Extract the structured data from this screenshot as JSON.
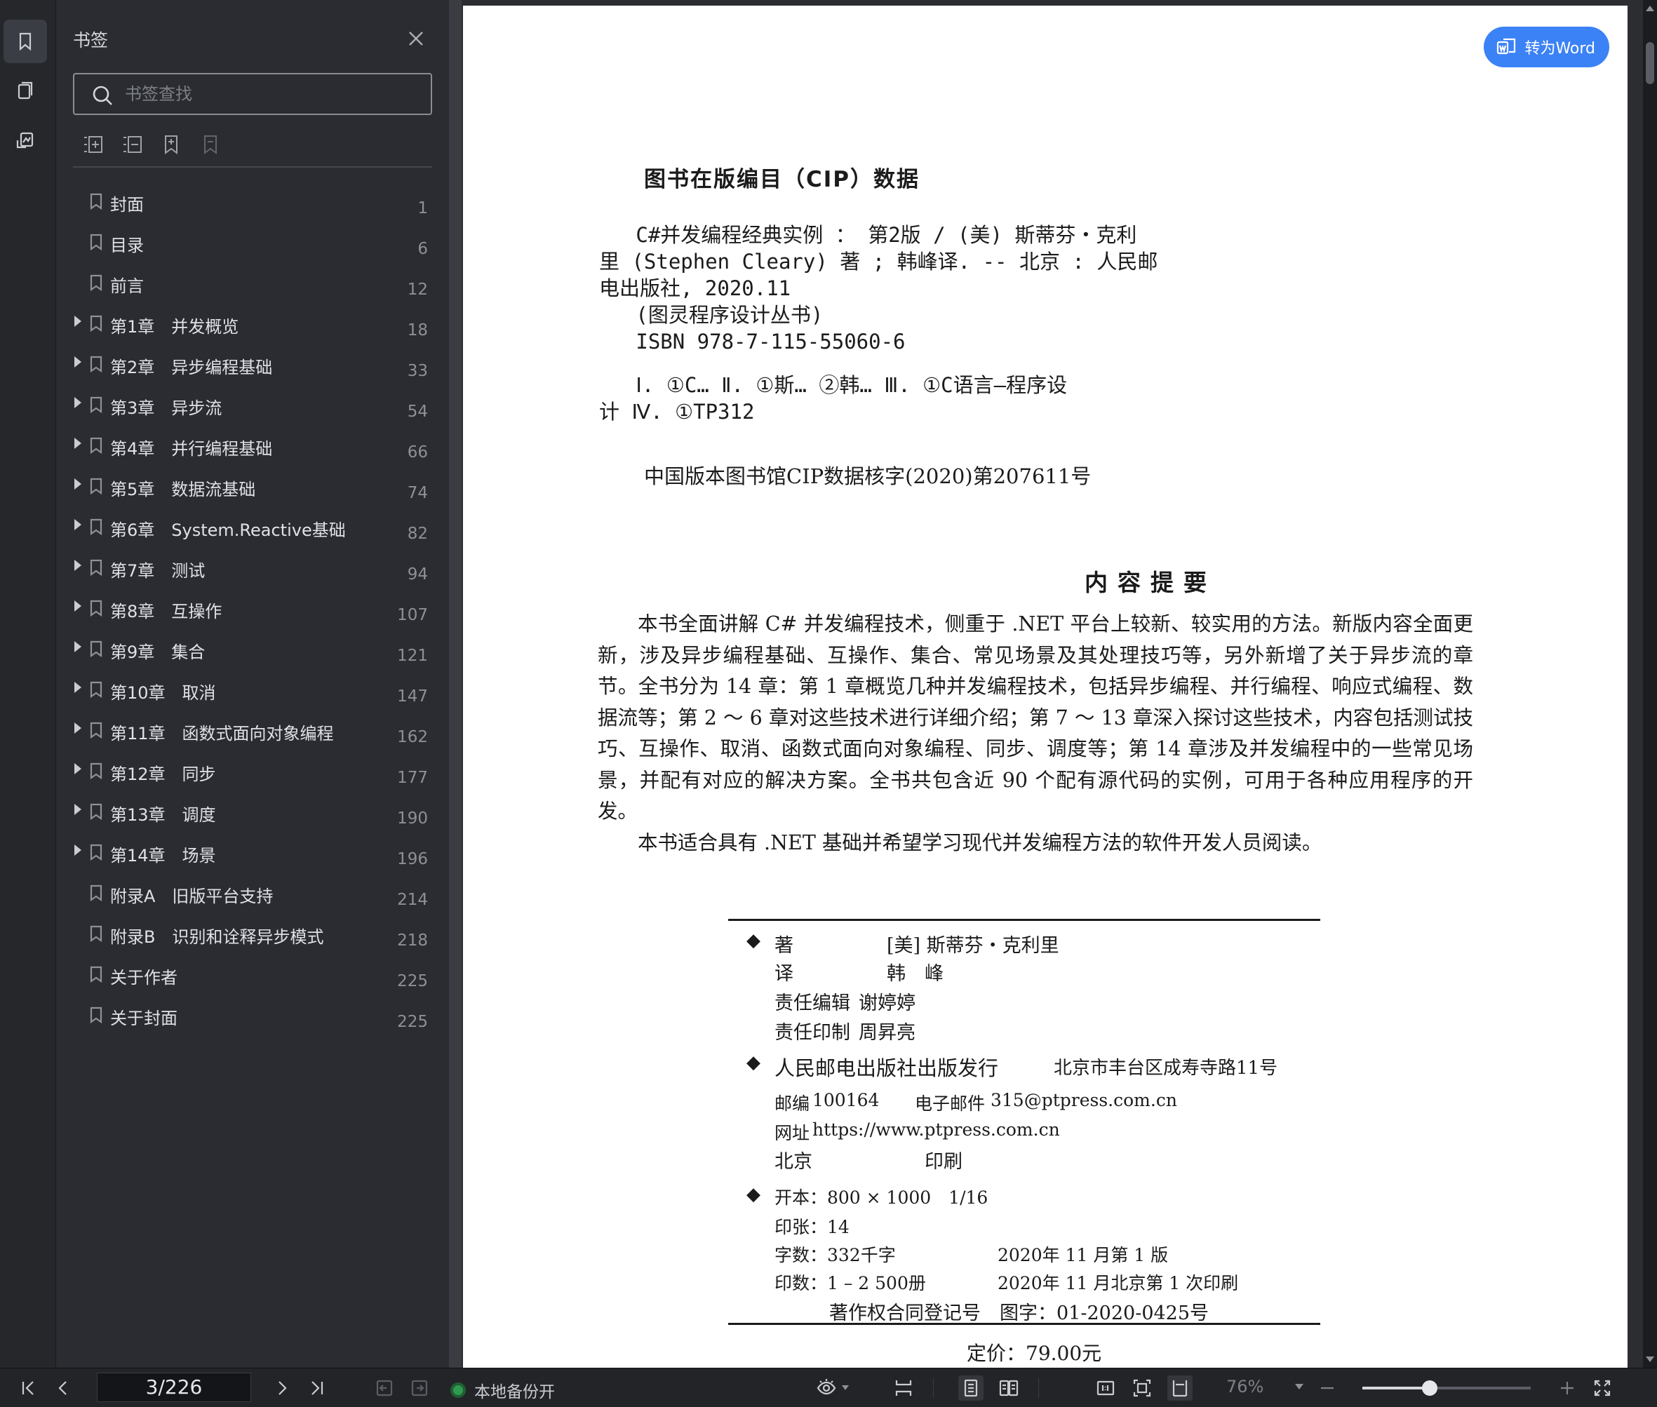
{
  "panel": {
    "title": "书签",
    "search_placeholder": "书签查找",
    "tools": [
      "expand-all-icon",
      "collapse-all-icon",
      "add-bookmark-icon",
      "remove-bookmark-icon"
    ],
    "items": [
      {
        "label": "封面",
        "page": "1",
        "expandable": false
      },
      {
        "label": "目录",
        "page": "6",
        "expandable": false
      },
      {
        "label": "前言",
        "page": "12",
        "expandable": false
      },
      {
        "label": "第1章　并发概览",
        "page": "18",
        "expandable": true
      },
      {
        "label": "第2章　异步编程基础",
        "page": "33",
        "expandable": true
      },
      {
        "label": "第3章　异步流",
        "page": "54",
        "expandable": true
      },
      {
        "label": "第4章　并行编程基础",
        "page": "66",
        "expandable": true
      },
      {
        "label": "第5章　数据流基础",
        "page": "74",
        "expandable": true
      },
      {
        "label": "第6章　System.Reactive基础",
        "page": "82",
        "expandable": true
      },
      {
        "label": "第7章　测试",
        "page": "94",
        "expandable": true
      },
      {
        "label": "第8章　互操作",
        "page": "107",
        "expandable": true
      },
      {
        "label": "第9章　集合",
        "page": "121",
        "expandable": true
      },
      {
        "label": "第10章　取消",
        "page": "147",
        "expandable": true
      },
      {
        "label": "第11章　函数式面向对象编程",
        "page": "162",
        "expandable": true
      },
      {
        "label": "第12章　同步",
        "page": "177",
        "expandable": true
      },
      {
        "label": "第13章　调度",
        "page": "190",
        "expandable": true
      },
      {
        "label": "第14章　场景",
        "page": "196",
        "expandable": true
      },
      {
        "label": "附录A　旧版平台支持",
        "page": "214",
        "expandable": false
      },
      {
        "label": "附录B　识别和诠释异步模式",
        "page": "218",
        "expandable": false
      },
      {
        "label": "关于作者",
        "page": "225",
        "expandable": false
      },
      {
        "label": "关于封面",
        "page": "225",
        "expandable": false
      }
    ]
  },
  "document": {
    "to_word_label": "转为Word",
    "cip_title": "图书在版编目（CIP）数据",
    "cip_lines": [
      "   C#并发编程经典实例 ： 第2版 / (美) 斯蒂芬・克利",
      "里 (Stephen Cleary) 著 ; 韩峰译. -- 北京 : 人民邮",
      "电出版社, 2020.11",
      "   (图灵程序设计丛书)",
      "   ISBN 978-7-115-55060-6",
      "",
      "   Ⅰ. ①C… Ⅱ. ①斯… ②韩… Ⅲ. ①C语言—程序设",
      "计 Ⅳ. ①TP312"
    ],
    "cip_number": "中国版本图书馆CIP数据核字(2020)第207611号",
    "abstract_title": "内容提要",
    "abstract_p1": "本书全面讲解 C# 并发编程技术，侧重于 .NET 平台上较新、较实用的方法。新版内容全面更新，涉及异步编程基础、互操作、集合、常见场景及其处理技巧等，另外新增了关于异步流的章节。全书分为 14 章：第 1 章概览几种并发编程技术，包括异步编程、并行编程、响应式编程、数据流等；第 2 ～ 6 章对这些技术进行详细介绍；第 7 ～ 13 章深入探讨这些技术，内容包括测试技巧、互操作、取消、函数式面向对象编程、同步、调度等；第 14 章涉及并发编程中的一些常见场景，并配有对应的解决方案。全书共包含近 90 个配有源代码的实例，可用于各种应用程序的开发。",
    "abstract_p2": "本书适合具有 .NET 基础并希望学习现代并发编程方法的软件开发人员阅读。",
    "credits": {
      "author_label": "著",
      "author": "[美] 斯蒂芬・克利里",
      "translator_label": "译",
      "translator": "韩　峰",
      "editor_label": "责任编辑",
      "editor": "谢婷婷",
      "print_label": "责任印制",
      "print": "周昇亮",
      "publisher": "人民邮电出版社出版发行",
      "address": "北京市丰台区成寿寺路11号",
      "postcode_label": "邮编",
      "postcode": "100164",
      "email_label": "电子邮件",
      "email": "315@ptpress.com.cn",
      "web_label": "网址",
      "web": "https://www.ptpress.com.cn",
      "city": "北京",
      "printing": "印刷",
      "format": "开本：800 × 1000　1/16",
      "sheets": "印张：14",
      "words": "字数：332千字",
      "edition": "2020年 11 月第 1 版",
      "copies": "印数：1 – 2 500册",
      "print_date": "2020年 11 月北京第 1 次印刷",
      "copyright": "著作权合同登记号　图字：01-2020-0425号",
      "price": "定价：79.00元"
    }
  },
  "statusbar": {
    "page_indicator": "3/226",
    "backup_label": "本地备份开",
    "zoom": "76%",
    "zoom_level": 0.4
  },
  "colors": {
    "accent": "#3b82f6",
    "backup_status": "#2e9b4e"
  }
}
